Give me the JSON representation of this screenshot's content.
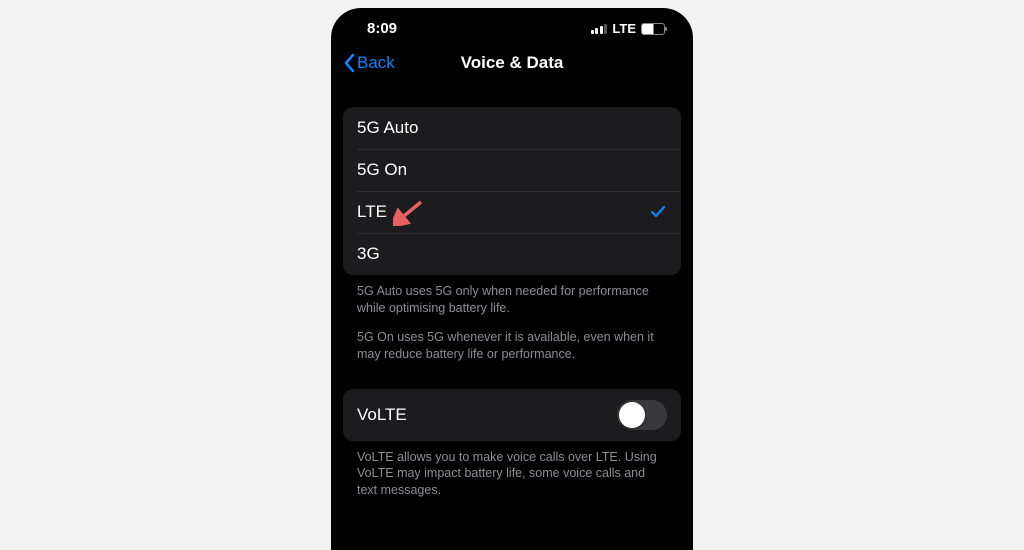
{
  "statusBar": {
    "time": "8:09",
    "network": "LTE",
    "battery": "53"
  },
  "nav": {
    "back": "Back",
    "title": "Voice & Data"
  },
  "options": {
    "items": [
      {
        "label": "5G Auto",
        "selected": false
      },
      {
        "label": "5G On",
        "selected": false
      },
      {
        "label": "LTE",
        "selected": true
      },
      {
        "label": "3G",
        "selected": false
      }
    ],
    "footer1": "5G Auto uses 5G only when needed for performance while optimising battery life.",
    "footer2": "5G On uses 5G whenever it is available, even when it may reduce battery life or performance."
  },
  "volte": {
    "label": "VoLTE",
    "enabled": false,
    "footer": "VoLTE allows you to make voice calls over LTE. Using VoLTE may impact battery life, some voice calls and text messages."
  },
  "annotation": {
    "arrowColor": "#e46160"
  }
}
